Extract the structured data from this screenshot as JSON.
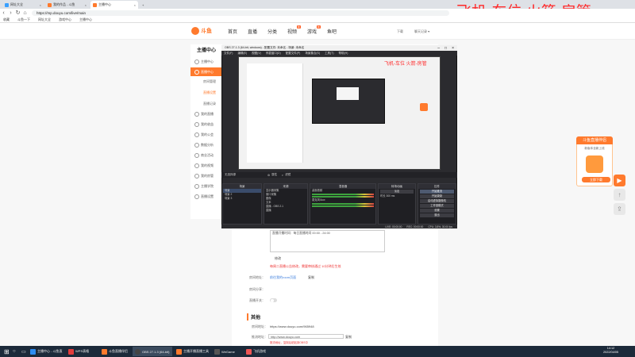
{
  "browser": {
    "tabs": [
      {
        "label": "网址大全",
        "color": "#3aa0ff",
        "active": false
      },
      {
        "label": "我的作品 - 斗鱼",
        "color": "#ff7a2d",
        "active": false
      },
      {
        "label": "主播中心",
        "color": "#ff7a2d",
        "active": true
      }
    ],
    "url": "https://mp.douyu.com/live/main",
    "bookmarks": [
      "收藏",
      "斗鱼一下",
      "网址大全",
      "游戏中心",
      "主播中心"
    ],
    "win_controls": [
      "–",
      "□",
      "×"
    ]
  },
  "overlay_text": "飞机-车位  火箭-房管",
  "site": {
    "logo": "斗鱼",
    "nav": [
      {
        "label": "首页",
        "badge": ""
      },
      {
        "label": "直播",
        "badge": ""
      },
      {
        "label": "分类",
        "badge": ""
      },
      {
        "label": "视频",
        "badge": "新"
      },
      {
        "label": "游戏",
        "badge": "新"
      },
      {
        "label": "鱼吧",
        "badge": ""
      }
    ],
    "header_right": [
      "下载",
      "聊天记录 ▾"
    ]
  },
  "sidebar": {
    "title": "主播中心",
    "items": [
      {
        "label": "主播中心",
        "active": false
      },
      {
        "label": "直播中心",
        "active": true
      },
      {
        "label": "我的直播",
        "active": false
      },
      {
        "label": "我的收益",
        "active": false
      },
      {
        "label": "我的公会",
        "active": false
      },
      {
        "label": "数据分析",
        "active": false
      },
      {
        "label": "商业活动",
        "active": false
      },
      {
        "label": "我的视频",
        "active": false
      },
      {
        "label": "我的房管",
        "active": false
      },
      {
        "label": "主播学院",
        "active": false
      },
      {
        "label": "直播设置",
        "active": false
      }
    ],
    "subitems": [
      {
        "label": "房间管理",
        "selected": false
      },
      {
        "label": "直播设置",
        "selected": true
      },
      {
        "label": "直播记录",
        "selected": false
      }
    ]
  },
  "main": {
    "schedule_note": "直播开播时间：每日直播时间 00:00 - 24:00",
    "notice_label": "修改",
    "notice_red": "每周二直播公告修改，需要审核通过 10分钟后生效",
    "link_label": "房间地址：",
    "link_value": "前往我的room页面",
    "link_action": "复制",
    "share_label": "房间分享：",
    "toggle_label": "直播开关：",
    "section_title": "其他",
    "room_url_label": "房间地址：",
    "room_url_value": "https://www.douyu.com/965948",
    "push_label": "推流地址：",
    "push_value": "http://www.douyu.com",
    "push_hint": "推流地址，复制后粘贴到OBS中",
    "copy_label": "复制"
  },
  "obs": {
    "title": "OBS 27.1.3 (64-bit, windows) - 配置文件: 未命名 - 场景: 未命名",
    "menu": [
      "文件(F)",
      "编辑(E)",
      "视图(V)",
      "停靠窗口(D)",
      "配置文件(P)",
      "场景集合(S)",
      "工具(T)",
      "帮助(H)"
    ],
    "preview_overlay": "飞机-车位  火箭-房管",
    "scene_bar": [
      "无选择源",
      "属性",
      "滤镜"
    ],
    "docks": {
      "scenes": {
        "title": "场景",
        "rows": [
          "场景",
          "场景 2",
          "场景 3"
        ]
      },
      "sources": {
        "title": "来源",
        "rows": [
          "显示器采集",
          "窗口采集",
          "图像",
          "文本",
          "直播 - OBS 2.1",
          "直播"
        ]
      },
      "mixer": {
        "title": "混音器",
        "rows": [
          "桌面音频",
          "麦克风/Aux"
        ]
      },
      "transitions": {
        "title": "转场动画",
        "rows": [
          "淡出",
          "时长 300 ms"
        ]
      },
      "controls": {
        "title": "控件",
        "buttons": [
          "开始推流",
          "开始录制",
          "启动虚拟摄像机",
          "工作室模式",
          "设置",
          "退出"
        ]
      }
    },
    "status": [
      "LIVE: 00:00:00",
      "REC: 00:00:00",
      "CPU: 3.8%, 30.00 fps"
    ]
  },
  "promo": {
    "header": "斗鱼直播伴侣",
    "text": "新版本全新上线",
    "button": "立即下载"
  },
  "taskbar": {
    "items": [
      {
        "label": "主播中心 - 斗鱼直",
        "color": "#2d8cf0",
        "active": false
      },
      {
        "label": "WPS表格",
        "color": "#e33c3c",
        "active": false
      },
      {
        "label": "斗鱼直播伴侣",
        "color": "#ff7a2d",
        "active": false
      },
      {
        "label": "OBS 27.1.3 (64-bit)",
        "color": "#444",
        "active": true
      },
      {
        "label": "主播开播直播工具",
        "color": "#ff7a2d",
        "active": false
      },
      {
        "label": "WeGame",
        "color": "#555",
        "active": false
      },
      {
        "label": "飞机游戏",
        "color": "#e55",
        "active": false
      }
    ],
    "time": "14:12",
    "date": "2022/04/05"
  },
  "colors": {
    "accent": "#ff7a2d",
    "overlay": "#ff2a2a"
  }
}
